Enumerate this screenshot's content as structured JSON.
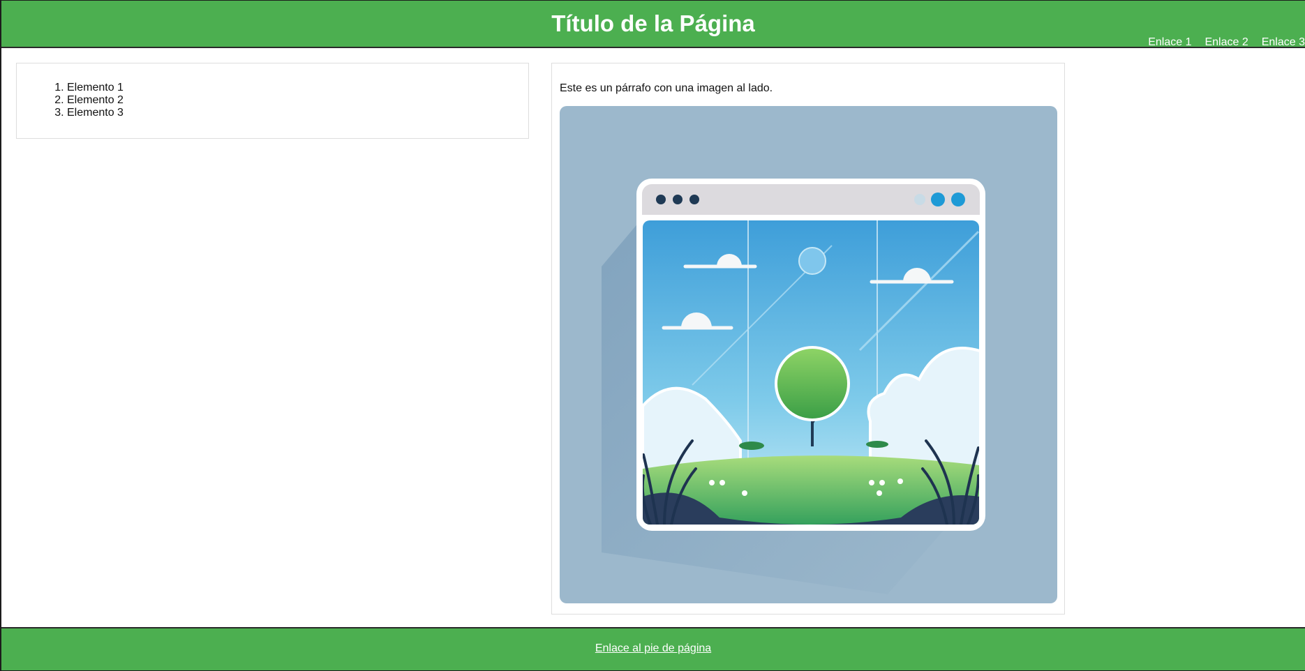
{
  "header": {
    "title": "Título de la Página",
    "nav": [
      "Enlace 1",
      "Enlace 2",
      "Enlace 3"
    ]
  },
  "left_panel": {
    "items": [
      "Elemento 1",
      "Elemento 2",
      "Elemento 3"
    ]
  },
  "right_panel": {
    "paragraph": "Este es un párrafo con una imagen al lado.",
    "image_icon": "landscape-browser-illustration"
  },
  "footer": {
    "link": "Enlace al pie de página"
  },
  "colors": {
    "brand_green": "#4caf50",
    "border": "#dddddd",
    "image_bg": "#9cb8cc"
  }
}
